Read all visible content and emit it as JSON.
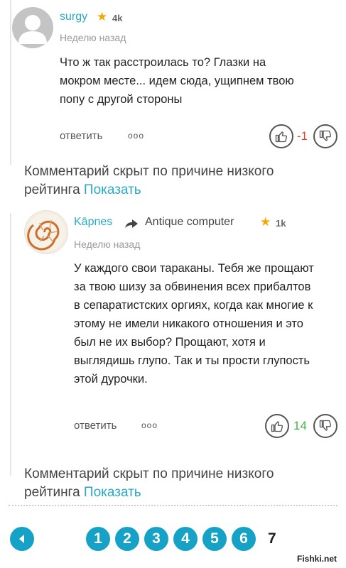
{
  "comment1": {
    "username": "surgy",
    "rating": "4k",
    "time": "Неделю назад",
    "text": "Что ж так расстроилась то? Глазки на мокром месте... идем сюда, ущипнем твою попу с другой стороны",
    "reply_label": "ответить",
    "more_label": "ooo",
    "vote_count": "-1",
    "vote_color": "#e0442f"
  },
  "hidden1": {
    "text": "Комментарий скрыт по причине низкого рейтинга",
    "show_label": "Показать"
  },
  "comment2": {
    "username": "Kāpnes",
    "reply_to": "Antique computer",
    "rating": "1k",
    "time": "Неделю назад",
    "text": "У каждого свои тараканы. Тебя же прощают за твою шизу за обвинения всех прибалтов в сепаратистских оргиях, когда как многие к этому не имели никакого отношения и это был не их выбор? Прощают, хотя и выглядишь глупо. Так и ты прости глупость этой дурочки.",
    "reply_label": "ответить",
    "more_label": "ooo",
    "vote_count": "14",
    "vote_color": "#4caf50"
  },
  "hidden2": {
    "text": "Комментарий скрыт по причине низкого рейтинга",
    "show_label": "Показать"
  },
  "pagination": {
    "pages": [
      "1",
      "2",
      "3",
      "4",
      "5",
      "6"
    ],
    "current": "7",
    "accent": "#16a2c7"
  },
  "watermark": "Fishki.net"
}
